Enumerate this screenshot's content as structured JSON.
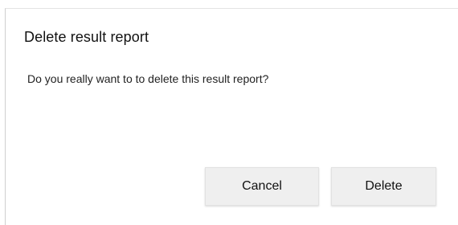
{
  "dialog": {
    "title": "Delete result report",
    "message": "Do you really want to to delete this result report?",
    "cancel_label": "Cancel",
    "delete_label": "Delete"
  }
}
